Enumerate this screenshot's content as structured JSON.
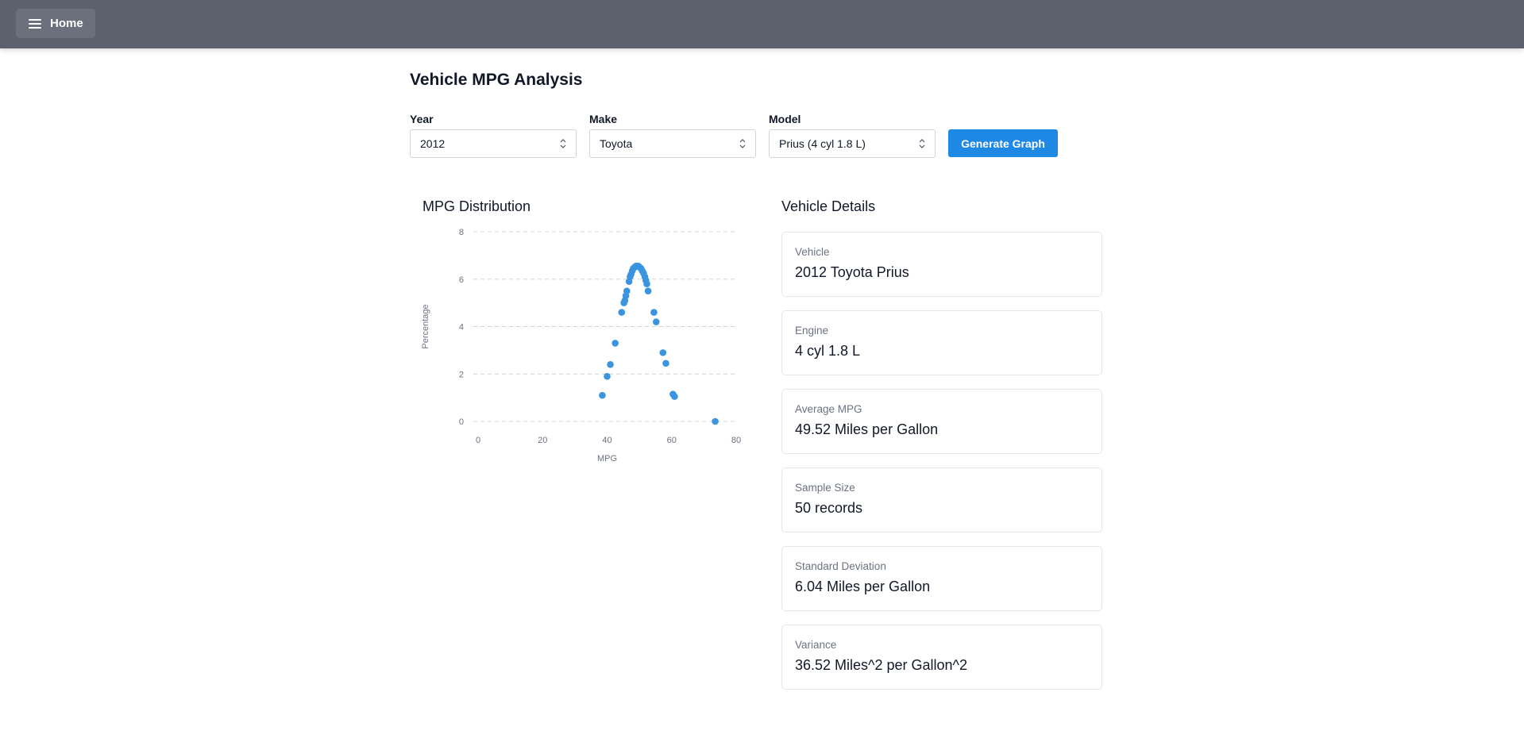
{
  "nav": {
    "home_label": "Home"
  },
  "page": {
    "title": "Vehicle MPG Analysis"
  },
  "filters": {
    "year": {
      "label": "Year",
      "value": "2012"
    },
    "make": {
      "label": "Make",
      "value": "Toyota"
    },
    "model": {
      "label": "Model",
      "value": "Prius (4 cyl 1.8 L)"
    },
    "generate_label": "Generate Graph"
  },
  "chart_section_title": "MPG Distribution",
  "details_title": "Vehicle Details",
  "details": [
    {
      "key": "Vehicle",
      "value": "2012 Toyota Prius"
    },
    {
      "key": "Engine",
      "value": "4 cyl 1.8 L"
    },
    {
      "key": "Average MPG",
      "value": "49.52 Miles per Gallon"
    },
    {
      "key": "Sample Size",
      "value": "50 records"
    },
    {
      "key": "Standard Deviation",
      "value": "6.04 Miles per Gallon"
    },
    {
      "key": "Variance",
      "value": "36.52 Miles^2 per Gallon^2"
    }
  ],
  "colors": {
    "accent": "#1e88e5",
    "point": "#3b94e0",
    "topbar": "#5b616d"
  },
  "chart_data": {
    "type": "scatter",
    "title": "",
    "xlabel": "MPG",
    "ylabel": "Percentage",
    "xlim": [
      0,
      80
    ],
    "ylim": [
      0,
      8
    ],
    "xticks": [
      0,
      20,
      40,
      60,
      80
    ],
    "yticks": [
      0,
      2,
      4,
      6,
      8
    ],
    "grid": "horizontal-dashed",
    "points": [
      [
        38.5,
        1.1
      ],
      [
        40.0,
        1.9
      ],
      [
        41.0,
        2.4
      ],
      [
        42.5,
        3.3
      ],
      [
        44.5,
        4.6
      ],
      [
        45.2,
        5.0
      ],
      [
        45.5,
        5.1
      ],
      [
        45.8,
        5.3
      ],
      [
        46.1,
        5.5
      ],
      [
        46.8,
        5.9
      ],
      [
        47.1,
        6.1
      ],
      [
        47.4,
        6.2
      ],
      [
        47.8,
        6.35
      ],
      [
        48.1,
        6.45
      ],
      [
        48.5,
        6.5
      ],
      [
        48.9,
        6.55
      ],
      [
        49.3,
        6.55
      ],
      [
        49.7,
        6.55
      ],
      [
        50.1,
        6.5
      ],
      [
        50.5,
        6.45
      ],
      [
        50.9,
        6.35
      ],
      [
        51.3,
        6.25
      ],
      [
        51.7,
        6.1
      ],
      [
        52.0,
        5.95
      ],
      [
        52.3,
        5.8
      ],
      [
        52.7,
        5.5
      ],
      [
        54.5,
        4.6
      ],
      [
        55.2,
        4.2
      ],
      [
        57.3,
        2.9
      ],
      [
        58.2,
        2.45
      ],
      [
        60.4,
        1.15
      ],
      [
        60.9,
        1.05
      ],
      [
        73.5,
        0.0
      ]
    ]
  }
}
